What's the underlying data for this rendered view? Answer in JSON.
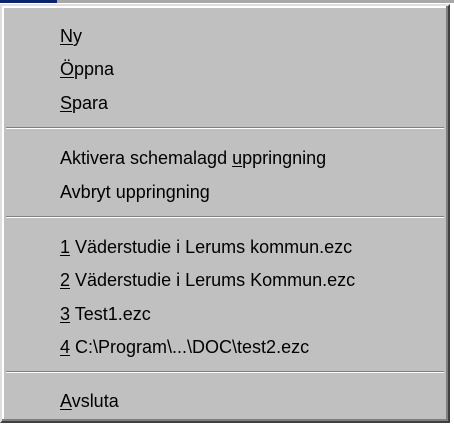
{
  "menu": {
    "groups": [
      {
        "items": [
          {
            "accel": "N",
            "rest": "y"
          },
          {
            "accel": "Ö",
            "rest": "ppna"
          },
          {
            "accel": "S",
            "rest": "para"
          }
        ]
      },
      {
        "items": [
          {
            "before": "Aktivera schemalagd ",
            "accel": "u",
            "rest": "ppringning"
          },
          {
            "before": "Avbryt uppringning",
            "accel": "",
            "rest": ""
          }
        ]
      },
      {
        "items": [
          {
            "accel": "1",
            "rest": " Väderstudie i Lerums kommun.ezc"
          },
          {
            "accel": "2",
            "rest": " Väderstudie i Lerums Kommun.ezc"
          },
          {
            "accel": "3",
            "rest": " Test1.ezc"
          },
          {
            "accel": "4",
            "rest": " C:\\Program\\...\\DOC\\test2.ezc"
          }
        ]
      },
      {
        "items": [
          {
            "accel": "A",
            "rest": "vsluta"
          }
        ]
      }
    ]
  }
}
